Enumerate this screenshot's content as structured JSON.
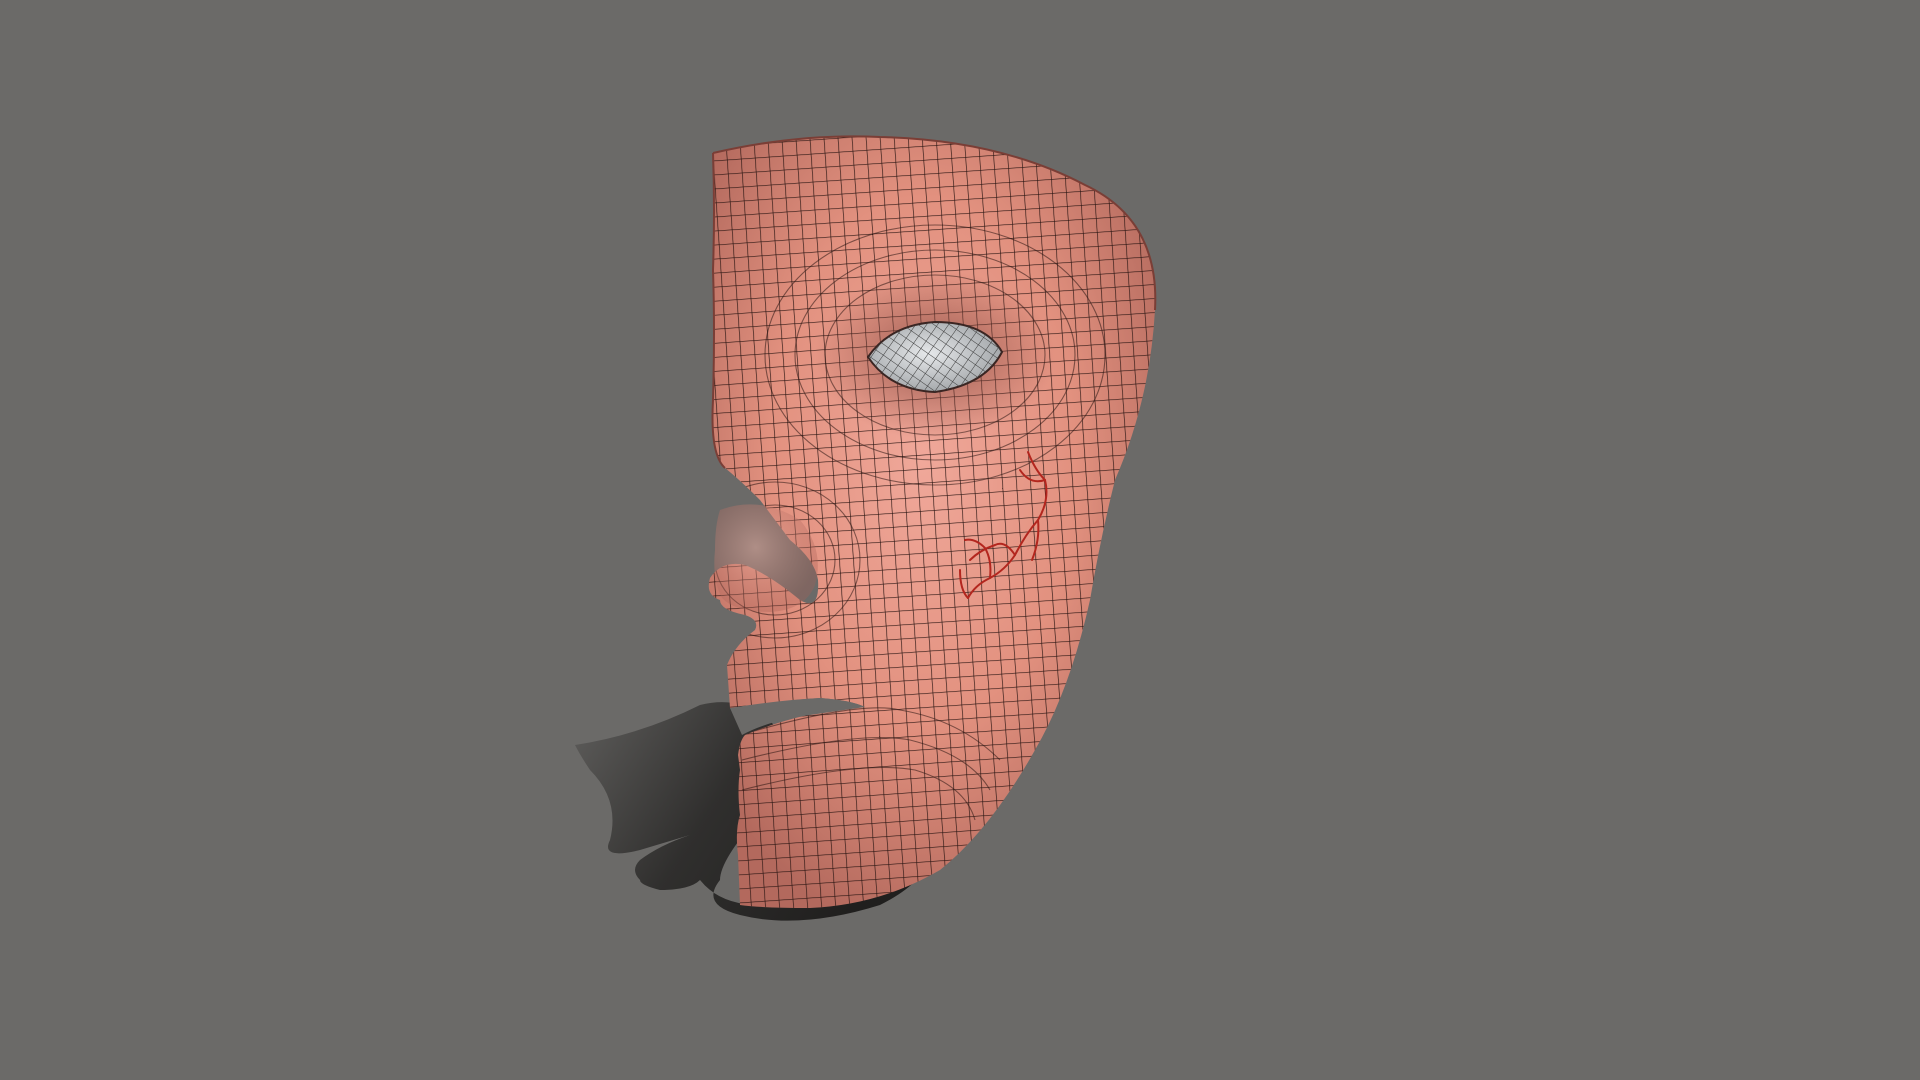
{
  "scene": {
    "subject": "half-face-mask-model",
    "render_mode": "wireframe-on-shaded",
    "colors": {
      "background": "#6b6a68",
      "skin_light": "#f0a89a",
      "skin_mid": "#d98a7c",
      "skin_dark": "#b3695d",
      "wire": "#2a1512",
      "eye": "#d4d6d8",
      "eye_wire": "#3a3a3a",
      "crack": "#b3261e",
      "shadow": "#1c1b1a"
    }
  }
}
